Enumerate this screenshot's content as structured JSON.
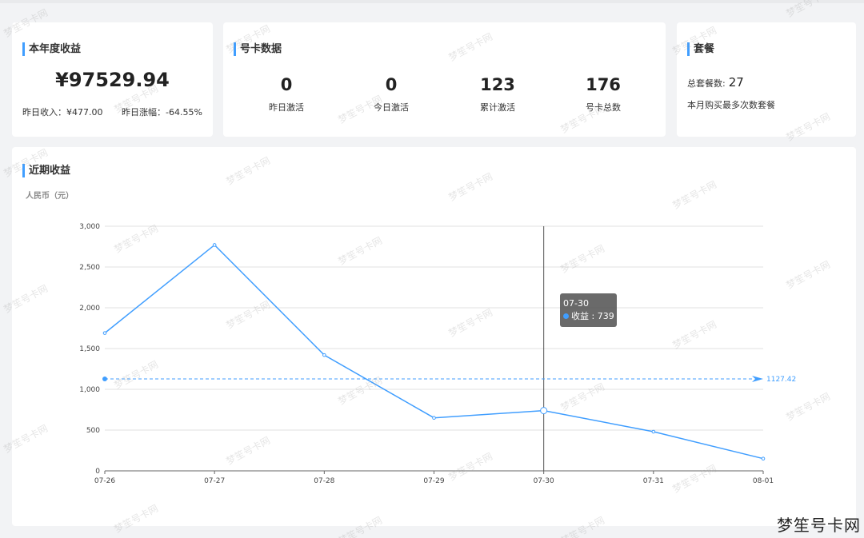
{
  "income": {
    "title": "本年度收益",
    "amount": "¥97529.94",
    "yesterday_income": "昨日收入：¥477.00",
    "yesterday_change": "昨日涨幅：-64.55%"
  },
  "card_data": {
    "title": "号卡数据",
    "stats": [
      {
        "value": "0",
        "label": "昨日激活"
      },
      {
        "value": "0",
        "label": "今日激活"
      },
      {
        "value": "123",
        "label": "累计激活"
      },
      {
        "value": "176",
        "label": "号卡总数"
      }
    ]
  },
  "package": {
    "title": "套餐",
    "total_label": "总套餐数:",
    "total_value": "27",
    "most_bought": "本月购买最多次数套餐"
  },
  "recent": {
    "title": "近期收益",
    "unit": "人民币（元）"
  },
  "tooltip": {
    "date": "07-30",
    "label": "收益 : 739"
  },
  "brand": "梦笙号卡网",
  "watermark": "梦笙号卡网",
  "colors": {
    "accent": "#409eff"
  },
  "chart_data": {
    "type": "line",
    "categories": [
      "07-26",
      "07-27",
      "07-28",
      "07-29",
      "07-30",
      "07-31",
      "08-01"
    ],
    "series": [
      {
        "name": "收益",
        "values": [
          1690,
          2770,
          1420,
          650,
          739,
          480,
          150
        ]
      }
    ],
    "ylim": [
      0,
      3000
    ],
    "yticks": [
      0,
      500,
      1000,
      1500,
      2000,
      2500,
      3000
    ],
    "average": 1127.42,
    "highlight": "07-30",
    "grid": true
  }
}
